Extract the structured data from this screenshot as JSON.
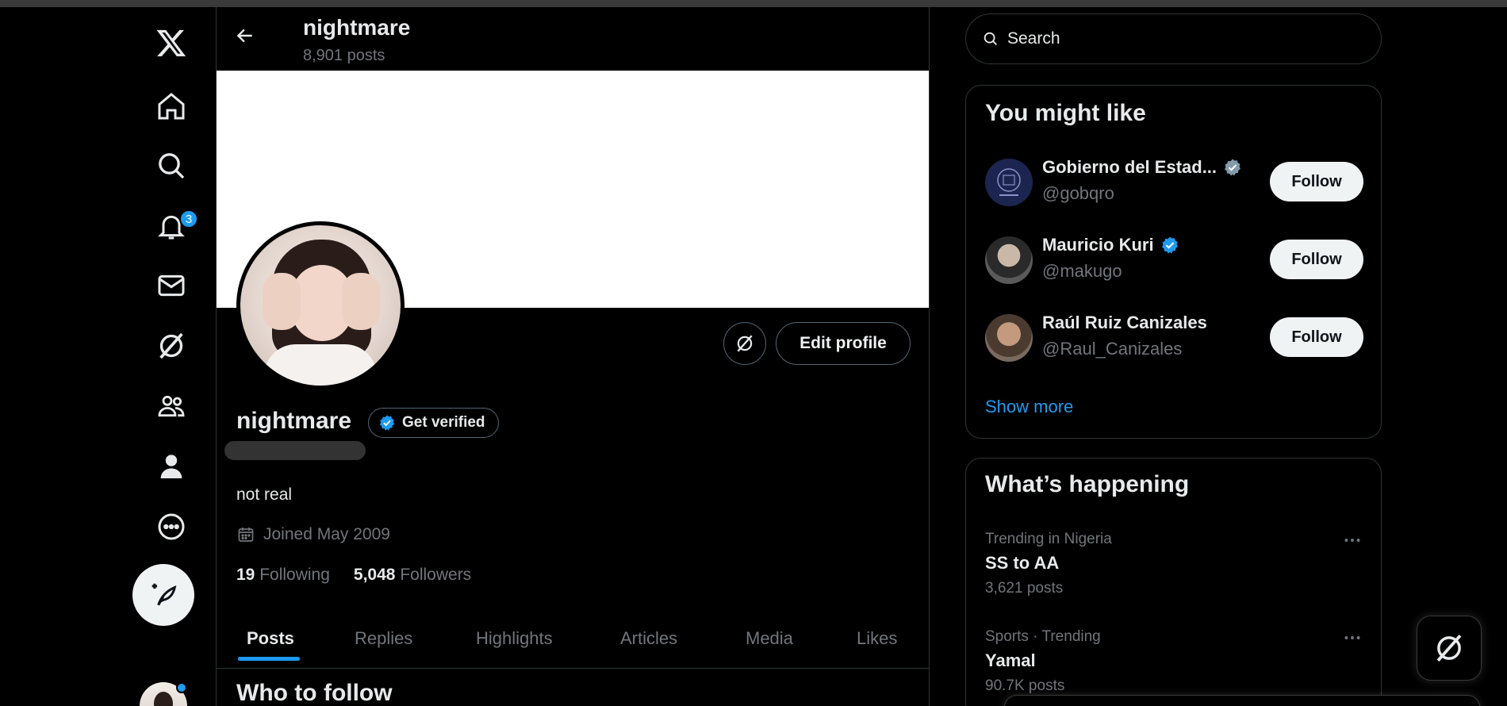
{
  "nav": {
    "notifications_badge": "3",
    "items": [
      "x-logo",
      "home",
      "explore",
      "notifications",
      "messages",
      "grok",
      "communities",
      "profile",
      "more"
    ]
  },
  "header": {
    "title": "nightmare",
    "post_count": "8,901 posts"
  },
  "profile": {
    "display_name": "nightmare",
    "get_verified_label": "Get verified",
    "bio": "not real",
    "joined": "Joined May 2009",
    "following_count": "19",
    "following_label": "Following",
    "followers_count": "5,048",
    "followers_label": "Followers",
    "edit_profile_label": "Edit profile"
  },
  "tabs": [
    "Posts",
    "Replies",
    "Highlights",
    "Articles",
    "Media",
    "Likes"
  ],
  "active_tab": "Posts",
  "who_to_follow_title": "Who to follow",
  "search": {
    "placeholder": "Search"
  },
  "you_might_like": {
    "title": "You might like",
    "accounts": [
      {
        "name": "Gobierno del Estad...",
        "handle": "@gobqro",
        "verified": "gray",
        "follow_label": "Follow"
      },
      {
        "name": "Mauricio Kuri",
        "handle": "@makugo",
        "verified": "blue",
        "follow_label": "Follow"
      },
      {
        "name": "Raúl Ruiz Canizales",
        "handle": "@Raul_Canizales",
        "verified": "none",
        "follow_label": "Follow"
      }
    ],
    "show_more_label": "Show more"
  },
  "whats_happening": {
    "title": "What’s happening",
    "trends": [
      {
        "context": "Trending in Nigeria",
        "title": "SS to AA",
        "count": "3,621 posts"
      },
      {
        "context": "Sports · Trending",
        "title": "Yamal",
        "count": "90.7K posts"
      }
    ]
  },
  "colors": {
    "accent": "#1d9bf0",
    "background": "#000000",
    "border": "#2f3336",
    "muted_text": "#71767b"
  }
}
